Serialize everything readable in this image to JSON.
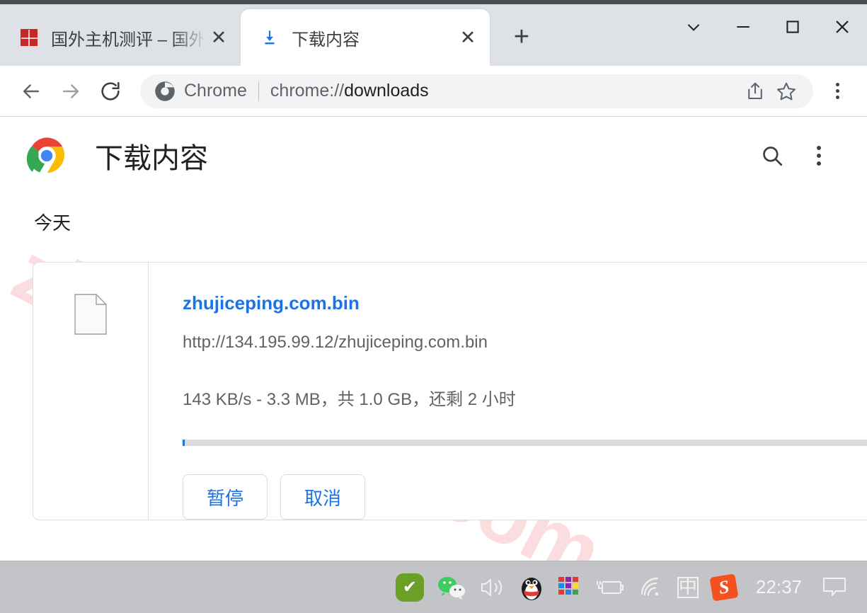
{
  "browser": {
    "tabs": [
      {
        "title": "国外主机测评 – 国外",
        "favicon": "red-square-favicon",
        "active": false,
        "close_label": "✕"
      },
      {
        "title": "下载内容",
        "favicon": "download-icon",
        "active": true,
        "close_label": "✕"
      }
    ],
    "new_tab_label": "+",
    "window_controls": [
      {
        "name": "tab-search-chevron",
        "glyph": "⌄"
      },
      {
        "name": "minimize",
        "glyph": "—"
      },
      {
        "name": "maximize",
        "glyph": "□"
      },
      {
        "name": "close",
        "glyph": "✕"
      }
    ],
    "toolbar": {
      "back_icon": "back-arrow-icon",
      "forward_icon": "forward-arrow-icon",
      "reload_icon": "reload-icon",
      "omnibox_label": "Chrome",
      "omnibox_scheme": "chrome://",
      "omnibox_path": "downloads",
      "share_icon": "share-icon",
      "bookmark_icon": "star-icon",
      "menu_icon": "three-dots-menu-icon"
    }
  },
  "downloads_page": {
    "title": "下载内容",
    "search_icon": "search-icon",
    "menu_icon": "three-dots-menu-icon",
    "watermark": "zhujiceping.com",
    "date_group": "今天",
    "item": {
      "file_name": "zhujiceping.com.bin",
      "url": "http://134.195.99.12/zhujiceping.com.bin",
      "status": "143 KB/s - 3.3 MB，共 1.0 GB，还剩 2 小时",
      "speed": "143 KB/s",
      "downloaded": "3.3 MB",
      "total": "1.0 GB",
      "remaining": "还剩 2 小时",
      "progress_percent": 0.3,
      "pause_label": "暂停",
      "cancel_label": "取消",
      "file_icon": "generic-file-icon"
    }
  },
  "taskbar": {
    "tray": [
      {
        "name": "security-check-icon",
        "glyph": "✔"
      },
      {
        "name": "wechat-icon",
        "glyph": ""
      },
      {
        "name": "volume-icon",
        "glyph": ""
      },
      {
        "name": "qq-penguin-icon",
        "glyph": ""
      },
      {
        "name": "color-grid-icon",
        "glyph": ""
      },
      {
        "name": "battery-icon",
        "glyph": ""
      },
      {
        "name": "wifi-icon",
        "glyph": ""
      },
      {
        "name": "ime-icon",
        "glyph": "中"
      },
      {
        "name": "sogou-icon",
        "glyph": "S"
      }
    ],
    "clock": "22:37",
    "notification_icon": "notification-bubble-icon"
  },
  "colors": {
    "accent_blue": "#1a73e8",
    "tabstrip_bg": "#dee1e6",
    "taskbar_bg": "#c3c4c7",
    "watermark_pink": "#fbdde0"
  }
}
